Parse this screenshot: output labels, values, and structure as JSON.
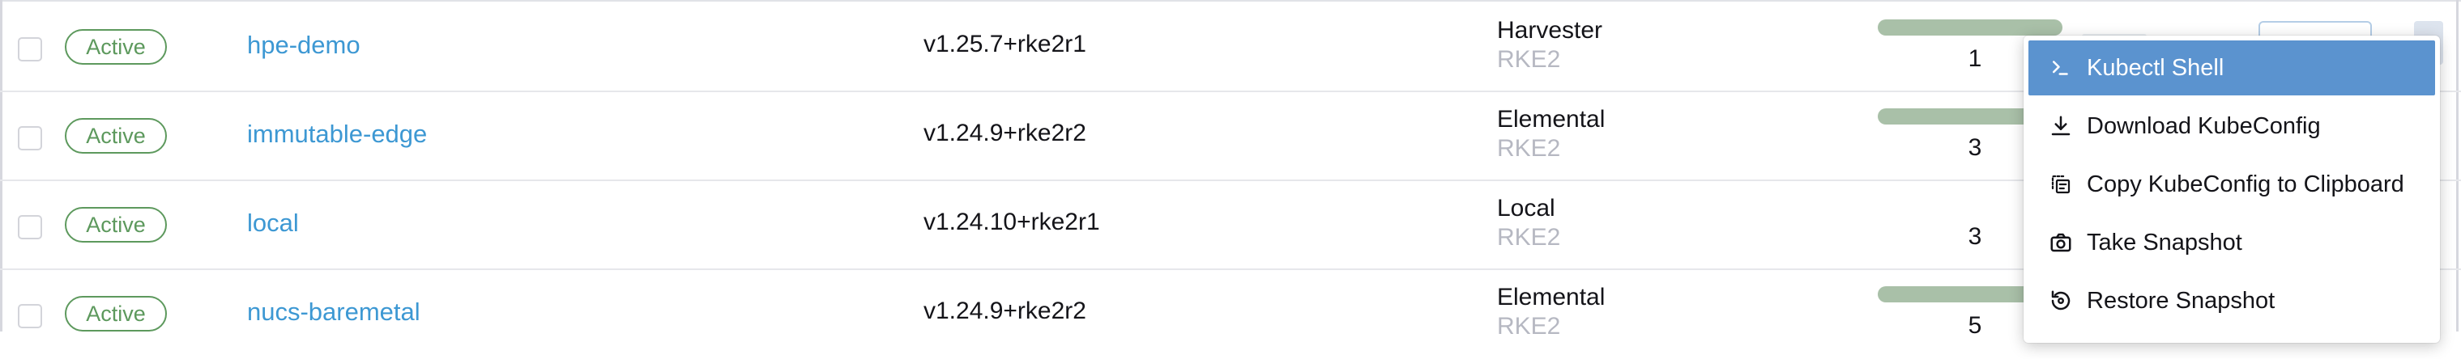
{
  "rows": [
    {
      "status": "Active",
      "name": "hpe-demo",
      "version": "v1.25.7+rke2r1",
      "provider": "Harvester",
      "distro": "RKE2",
      "nodes": "1"
    },
    {
      "status": "Active",
      "name": "immutable-edge",
      "version": "v1.24.9+rke2r2",
      "provider": "Elemental",
      "distro": "RKE2",
      "nodes": "3"
    },
    {
      "status": "Active",
      "name": "local",
      "version": "v1.24.10+rke2r1",
      "provider": "Local",
      "distro": "RKE2",
      "nodes": "3"
    },
    {
      "status": "Active",
      "name": "nucs-baremetal",
      "version": "v1.24.9+rke2r2",
      "provider": "Elemental",
      "distro": "RKE2",
      "nodes": "5"
    }
  ],
  "menu": {
    "items": [
      {
        "label": "Kubectl Shell",
        "icon": "terminal-icon",
        "active": true
      },
      {
        "label": "Download KubeConfig",
        "icon": "download-icon"
      },
      {
        "label": "Copy KubeConfig to Clipboard",
        "icon": "copy-icon"
      },
      {
        "label": "Take Snapshot",
        "icon": "camera-icon"
      },
      {
        "label": "Restore Snapshot",
        "icon": "restore-icon"
      }
    ]
  },
  "colors": {
    "link": "#3d98d3",
    "active_badge": "#5d995d",
    "menu_highlight": "#5b93cf",
    "muted_text": "#b6b8c2",
    "progress_bar": "#a9c0a8"
  }
}
